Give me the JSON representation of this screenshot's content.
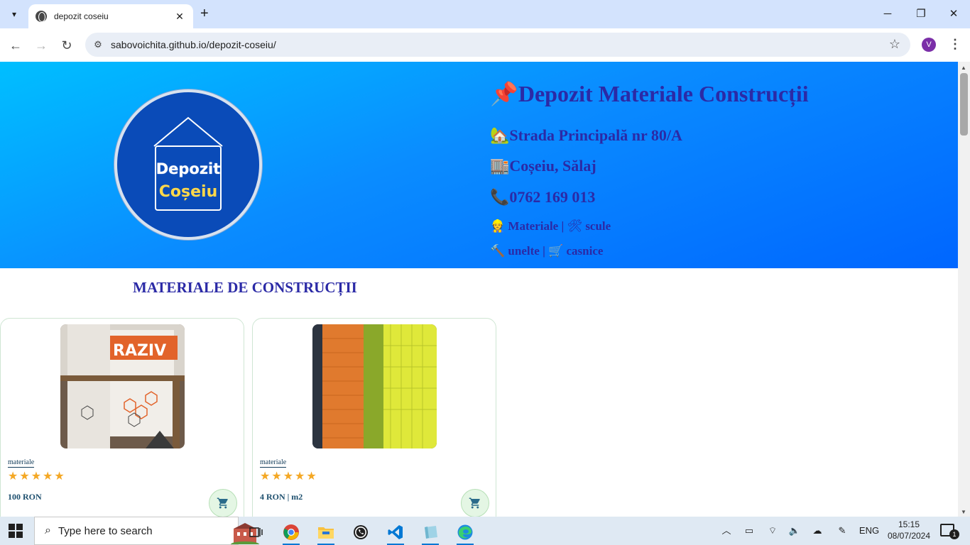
{
  "browser": {
    "tab_title": "depozit coseiu",
    "url": "sabovoichita.github.io/depozit-coseiu/",
    "profile_initial": "V"
  },
  "hero": {
    "logo_line1": "Depozit",
    "logo_line2": "Coșeiu",
    "title": "Depozit Materiale Construcții",
    "title_icon": "📌",
    "address": "Strada Principală nr 80/A",
    "address_icon": "🏡",
    "city": "Coșeiu, Sălaj",
    "city_icon": "🏬",
    "phone": "0762 169 013",
    "phone_icon": "📞",
    "line1_icon1": "👷",
    "line1_a": "Materiale",
    "line1_sep": "|",
    "line1_icon2": "🛠",
    "line1_b": "scule",
    "line2_icon1": "🔨",
    "line2_a": "unelte",
    "line2_sep": "|",
    "line2_icon2": "🛒",
    "line2_b": "casnice"
  },
  "section": {
    "title": "MATERIALE DE CONSTRUCȚII"
  },
  "products": [
    {
      "category": "materiale",
      "rating": 5,
      "stars": "★★★★★",
      "price": "100 RON",
      "photo_label": "RAZIV"
    },
    {
      "category": "materiale",
      "rating": 5,
      "stars": "★★★★★",
      "price": "4 RON | m2"
    }
  ],
  "taskbar": {
    "search_placeholder": "Type here to search",
    "language": "ENG",
    "time": "15:15",
    "date": "08/07/2024",
    "notification_count": "1"
  },
  "colors": {
    "hero_gradient_start": "#00bfff",
    "hero_gradient_end": "#0066ff",
    "heading_text": "#2b2aa6",
    "logo_bg": "#0a4bb8",
    "star": "#f4a825",
    "cart_bg": "#e4f6e4"
  }
}
